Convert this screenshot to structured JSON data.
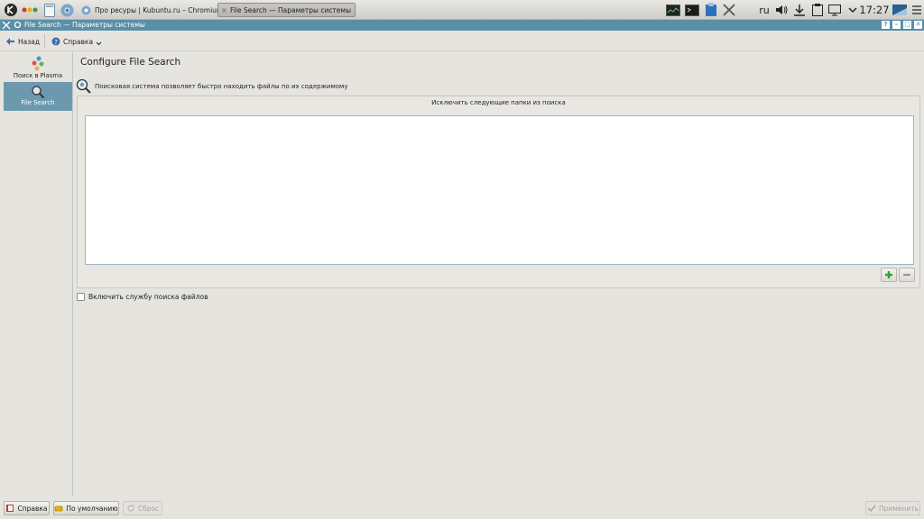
{
  "taskbar": {
    "tasks": [
      {
        "label": "Про ресуры | Kubuntu.ru – Chromium"
      },
      {
        "label": "File Search  — Параметры системы"
      }
    ],
    "lang": "ru",
    "clock": "17:27"
  },
  "window": {
    "title": "File Search  — Параметры системы",
    "title_buttons": [
      "?",
      "–",
      "□",
      "✕"
    ]
  },
  "toolbar": {
    "back_label": "Назад",
    "help_label": "Справка"
  },
  "sidebar": {
    "items": [
      {
        "label": "Поиск в Plasma",
        "icon": "plasma-search-icon"
      },
      {
        "label": "File Search",
        "icon": "magnifier-icon",
        "selected": true
      }
    ]
  },
  "main": {
    "title": "Configure File Search",
    "description": "Поисковая система позволяет быстро находить файлы по их содержимому",
    "exclude_group_title": "Исключить следующие папки из поиска",
    "excluded_folders": [],
    "enable_checkbox_label": "Включить службу поиска файлов",
    "enable_checked": false
  },
  "footer": {
    "help_label": "Справка",
    "defaults_label": "По умолчанию",
    "reset_label": "Сброс",
    "apply_label": "Применить"
  },
  "colors": {
    "titlebar": "#5a8fa8",
    "selected_item": "#6d99ae",
    "add_green": "#2ea52e"
  }
}
